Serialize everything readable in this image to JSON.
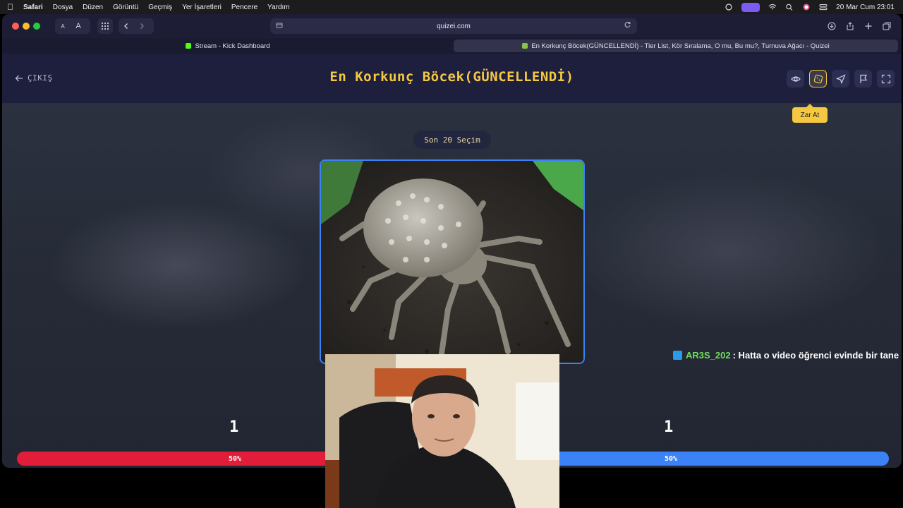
{
  "menubar": {
    "app": "Safari",
    "items": [
      "Dosya",
      "Düzen",
      "Görüntü",
      "Geçmiş",
      "Yer İşaretleri",
      "Pencere",
      "Yardım"
    ],
    "datetime": "20 Mar Cum  23:01"
  },
  "browser": {
    "url": "quizei.com",
    "tabs": [
      {
        "label": "Stream - Kick Dashboard",
        "active": false
      },
      {
        "label": "En Korkunç Böcek(GÜNCELLENDİ) - Tier List, Kör Sıralama, O mu, Bu mu?, Turnuva Ağacı - Quizei",
        "active": true
      }
    ],
    "reader_small": "A",
    "reader_large": "A"
  },
  "page": {
    "back_label": "ÇIKIŞ",
    "title": "En Korkunç Böcek(GÜNCELLENDİ)",
    "tooltip": "Zar At",
    "round_label": "Son 20 Seçim",
    "left_count": "1",
    "right_count": "1",
    "left_percent_label": "50%",
    "right_percent_label": "50%",
    "left_percent": 0.5,
    "right_percent": 0.5,
    "left_color": "#e11d3a",
    "right_color": "#3b82f6",
    "accent": "#f5c842"
  },
  "chat": {
    "username": "AR3S_202",
    "message": ": Hatta o video öğrenci evinde bir tane"
  }
}
